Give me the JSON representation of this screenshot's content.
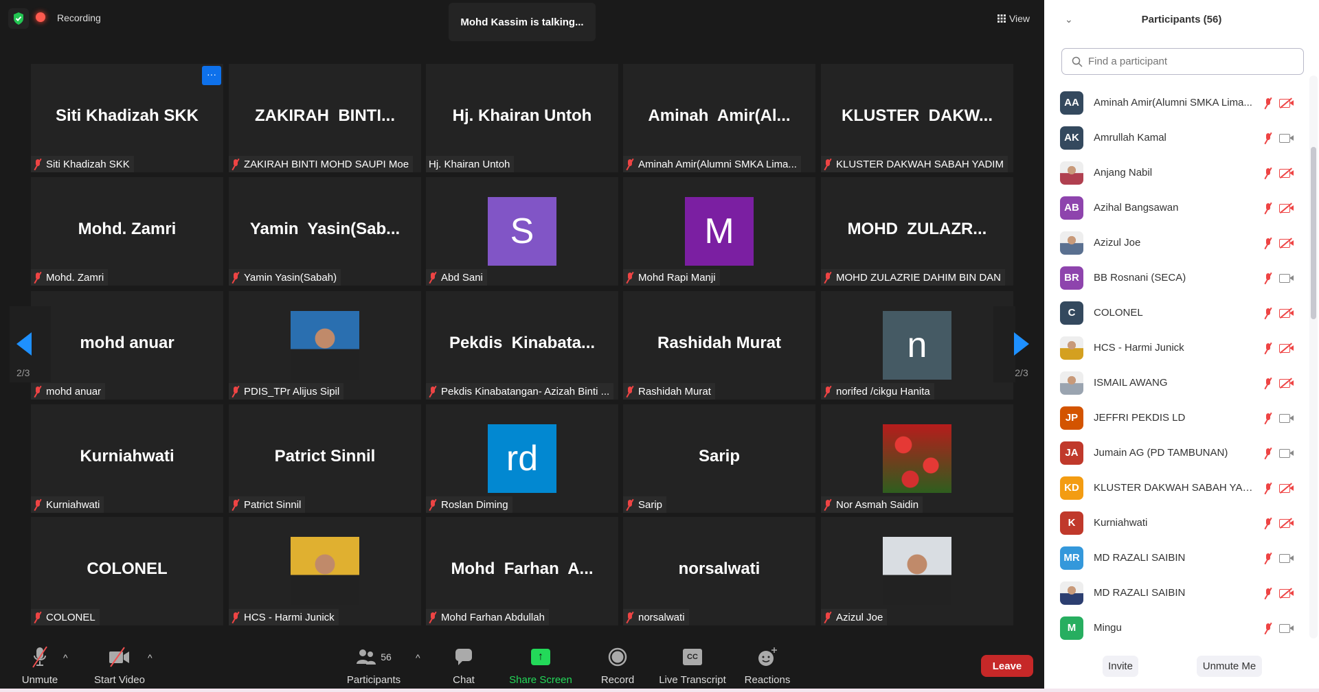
{
  "top": {
    "recording": "Recording",
    "talking": "Mohd Kassim is talking...",
    "view": "View",
    "more": "···"
  },
  "tiles": [
    {
      "big": "Siti Khadizah SKK",
      "label": "Siti Khadizah SKK",
      "muted": true,
      "more": true
    },
    {
      "big": "ZAKIRAH  BINTI...",
      "label": "ZAKIRAH BINTI MOHD SAUPI Moe",
      "muted": true
    },
    {
      "big": "Hj. Khairan Untoh",
      "label": "Hj. Khairan Untoh",
      "muted": false
    },
    {
      "big": "Aminah  Amir(Al...",
      "label": "Aminah Amir(Alumni SMKA Lima...",
      "muted": true
    },
    {
      "big": "KLUSTER  DAKW...",
      "label": "KLUSTER DAKWAH SABAH YADIM",
      "muted": true
    },
    {
      "big": "Mohd. Zamri",
      "label": "Mohd. Zamri",
      "muted": true
    },
    {
      "big": "Yamin  Yasin(Sab...",
      "label": "Yamin Yasin(Sabah)",
      "muted": true
    },
    {
      "avatar": "S",
      "color": "#8155c6",
      "label": "Abd Sani",
      "muted": true
    },
    {
      "avatar": "M",
      "color": "#7b1fa2",
      "label": "Mohd Rapi Manji",
      "muted": true
    },
    {
      "big": "MOHD  ZULAZR...",
      "label": "MOHD ZULAZRIE DAHIM BIN DAN",
      "muted": true
    },
    {
      "big": "mohd anuar",
      "label": "mohd anuar",
      "muted": true
    },
    {
      "photo": "portrait",
      "color": "#2a6fb0",
      "label": "PDIS_TPr Alijus Sipil",
      "muted": true
    },
    {
      "big": "Pekdis  Kinabata...",
      "label": "Pekdis Kinabatangan- Azizah Binti ...",
      "muted": true
    },
    {
      "big": "Rashidah Murat",
      "label": "Rashidah Murat",
      "muted": true
    },
    {
      "avatar": "n",
      "color": "#455a64",
      "label": "norifed /cikgu Hanita",
      "muted": true
    },
    {
      "big": "Kurniahwati",
      "label": "Kurniahwati",
      "muted": true
    },
    {
      "big": "Patrict Sinnil",
      "label": "Patrict Sinnil",
      "muted": true
    },
    {
      "avatar": "rd",
      "color": "#0288d1",
      "label": "Roslan Diming",
      "muted": true
    },
    {
      "big": "Sarip",
      "label": "Sarip",
      "muted": true
    },
    {
      "photo": "roses",
      "color": "#c62828",
      "label": "Nor Asmah Saidin",
      "muted": true
    },
    {
      "big": "COLONEL",
      "label": "COLONEL",
      "muted": true
    },
    {
      "photo": "portrait",
      "color": "#e0b030",
      "label": "HCS - Harmi Junick",
      "muted": true
    },
    {
      "big": "Mohd  Farhan  A...",
      "label": "Mohd Farhan Abdullah",
      "muted": true
    },
    {
      "big": "norsalwati",
      "label": "norsalwati",
      "muted": true
    },
    {
      "photo": "portrait",
      "color": "#d9dde2",
      "label": "Azizul Joe",
      "muted": true
    }
  ],
  "pager": {
    "left": "2/3",
    "right": "2/3"
  },
  "toolbar": {
    "unmute": "Unmute",
    "start_video": "Start Video",
    "participants": "Participants",
    "participants_count": "56",
    "chat": "Chat",
    "share": "Share Screen",
    "record": "Record",
    "transcript": "Live Transcript",
    "transcript_icon": "CC",
    "reactions": "Reactions",
    "leave": "Leave",
    "share_color": "#23d959",
    "leave_color": "#c62828"
  },
  "sidebar": {
    "title": "Participants (56)",
    "search_placeholder": "Find a participant",
    "invite": "Invite",
    "unmute_me": "Unmute Me",
    "participants": [
      {
        "initials": "AA",
        "color": "#34495e",
        "name": "Aminah Amir(Alumni SMKA Lima...",
        "cam": "off"
      },
      {
        "initials": "AK",
        "color": "#34495e",
        "name": "Amrullah Kamal",
        "cam": "on"
      },
      {
        "photo": true,
        "color": "#b04050",
        "name": "Anjang Nabil",
        "cam": "off"
      },
      {
        "initials": "AB",
        "color": "#8e44ad",
        "name": "Azihal Bangsawan",
        "cam": "off"
      },
      {
        "photo": true,
        "color": "#5a7090",
        "name": "Azizul Joe",
        "cam": "off"
      },
      {
        "initials": "BR",
        "color": "#8e44ad",
        "name": "BB Rosnani  (SECA)",
        "cam": "on"
      },
      {
        "initials": "C",
        "color": "#34495e",
        "name": "COLONEL",
        "cam": "off"
      },
      {
        "photo": true,
        "color": "#d4a020",
        "name": "HCS - Harmi Junick",
        "cam": "off"
      },
      {
        "photo": true,
        "color": "#9aa4b0",
        "name": "ISMAIL AWANG",
        "cam": "off"
      },
      {
        "initials": "JP",
        "color": "#d35400",
        "name": "JEFFRI PEKDIS LD",
        "cam": "on"
      },
      {
        "initials": "JA",
        "color": "#c0392b",
        "name": "Jumain AG (PD TAMBUNAN)",
        "cam": "on"
      },
      {
        "initials": "KD",
        "color": "#f39c12",
        "name": "KLUSTER DAKWAH SABAH YADIM",
        "cam": "off"
      },
      {
        "initials": "K",
        "color": "#c0392b",
        "name": "Kurniahwati",
        "cam": "off"
      },
      {
        "initials": "MR",
        "color": "#3498db",
        "name": "MD RAZALI SAIBIN",
        "cam": "on"
      },
      {
        "photo": true,
        "color": "#2c3e70",
        "name": "MD RAZALI SAIBIN",
        "cam": "off"
      },
      {
        "initials": "M",
        "color": "#27ae60",
        "name": "Mingu",
        "cam": "on"
      }
    ]
  }
}
